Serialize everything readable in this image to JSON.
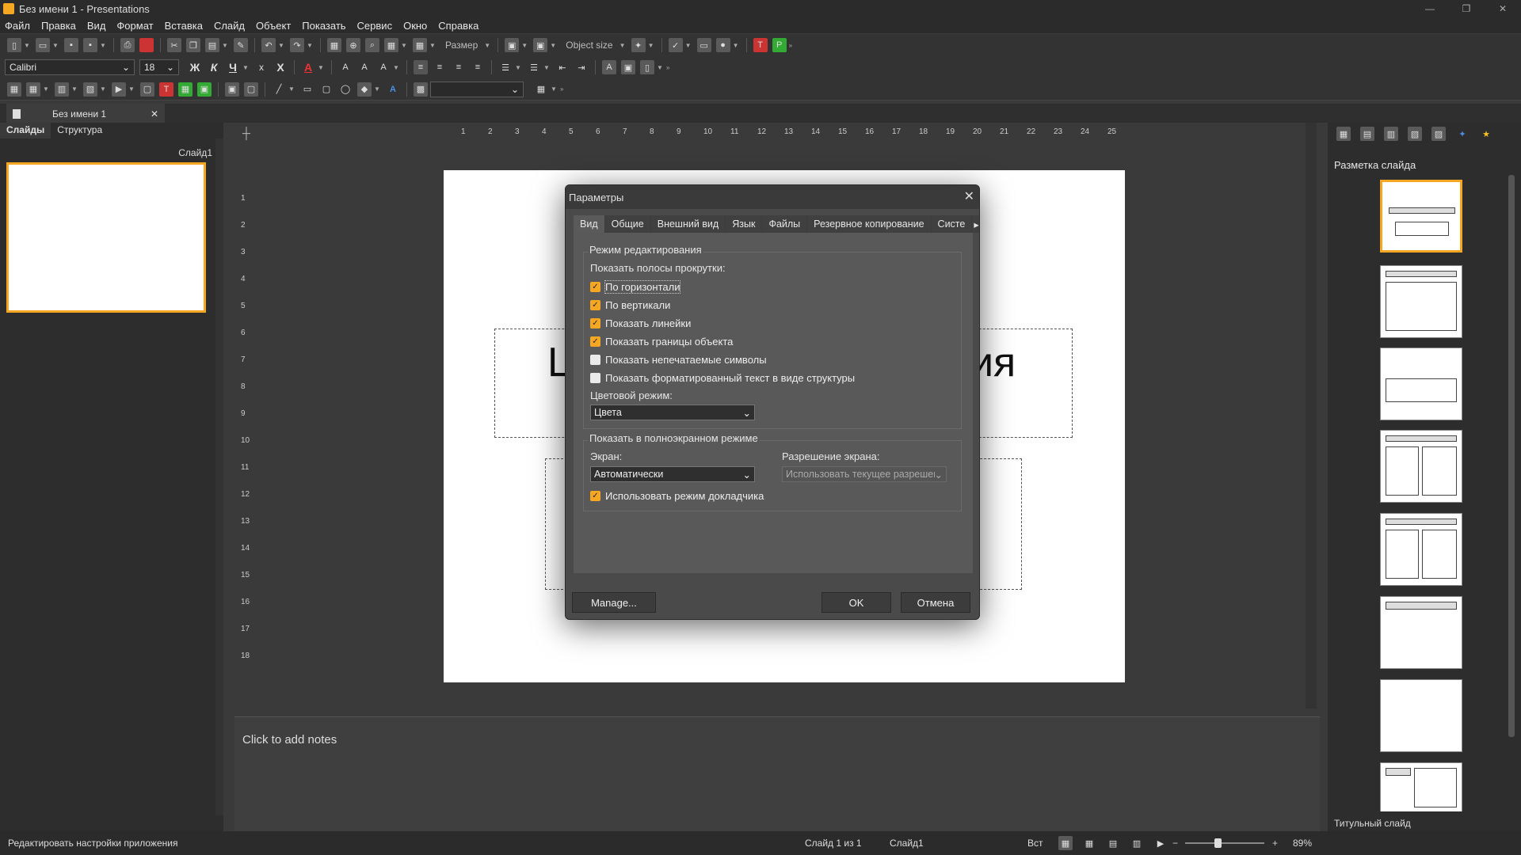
{
  "window": {
    "title": "Без имени 1 - Presentations",
    "controls": [
      "—",
      "❐",
      "✕"
    ]
  },
  "menu": [
    "Файл",
    "Правка",
    "Вид",
    "Формат",
    "Вставка",
    "Слайд",
    "Объект",
    "Показать",
    "Сервис",
    "Окно",
    "Справка"
  ],
  "toolbar": {
    "size_label": "Размер",
    "object_size_label": "Object size",
    "font_name": "Calibri",
    "font_size": "18",
    "bold": "Ж",
    "italic": "К",
    "underline": "Ч",
    "strike": "X",
    "color_a": "A"
  },
  "doc_tab": {
    "label": "Без имени 1"
  },
  "left_panel": {
    "tab_slides": "Слайды",
    "tab_structure": "Структура",
    "slide_label": "Слайд1"
  },
  "slide": {
    "title_left": "Ц",
    "title_right": "ия"
  },
  "ruler_h": [
    "1",
    "2",
    "3",
    "4",
    "5",
    "6",
    "7",
    "8",
    "9",
    "10",
    "11",
    "12",
    "13",
    "14",
    "15",
    "16",
    "17",
    "18",
    "19",
    "20",
    "21",
    "22",
    "23",
    "24",
    "25"
  ],
  "ruler_v": [
    "1",
    "2",
    "3",
    "4",
    "5",
    "6",
    "7",
    "8",
    "9",
    "10",
    "11",
    "12",
    "13",
    "14",
    "15",
    "16",
    "17",
    "18"
  ],
  "notes": {
    "placeholder": "Click to add notes"
  },
  "right_panel": {
    "title": "Разметка слайда",
    "footer": "Титульный слайд"
  },
  "dialog": {
    "title": "Параметры",
    "tabs": [
      "Вид",
      "Общие",
      "Внешний вид",
      "Язык",
      "Файлы",
      "Резервное копирование",
      "Систе"
    ],
    "group1_title": "Режим редактирования",
    "scroll_label": "Показать полосы прокрутки:",
    "checks": [
      {
        "label": "По горизонтали",
        "checked": true
      },
      {
        "label": "По вертикали",
        "checked": true
      },
      {
        "label": "Показать линейки",
        "checked": true
      },
      {
        "label": "Показать границы объекта",
        "checked": true
      },
      {
        "label": "Показать непечатаемые символы",
        "checked": false
      },
      {
        "label": "Показать форматированный текст в виде структуры",
        "checked": false
      }
    ],
    "color_mode_label": "Цветовой режим:",
    "color_mode_value": "Цвета",
    "group2_title": "Показать в полноэкранном режиме",
    "screen_label": "Экран:",
    "screen_value": "Автоматически",
    "resolution_label": "Разрешение экрана:",
    "resolution_value": "Использовать текущее разрешен",
    "presenter_label": "Использовать режим докладчика",
    "presenter_checked": true,
    "manage_button": "Manage...",
    "ok_button": "OK",
    "cancel_button": "Отмена"
  },
  "status": {
    "left": "Редактировать настройки приложения",
    "slide_count": "Слайд 1 из 1",
    "slide_name": "Слайд1",
    "mode": "Вст",
    "zoom": "89%"
  },
  "colors": {
    "accent": "#f5a623",
    "bg": "#3a3a3a"
  }
}
